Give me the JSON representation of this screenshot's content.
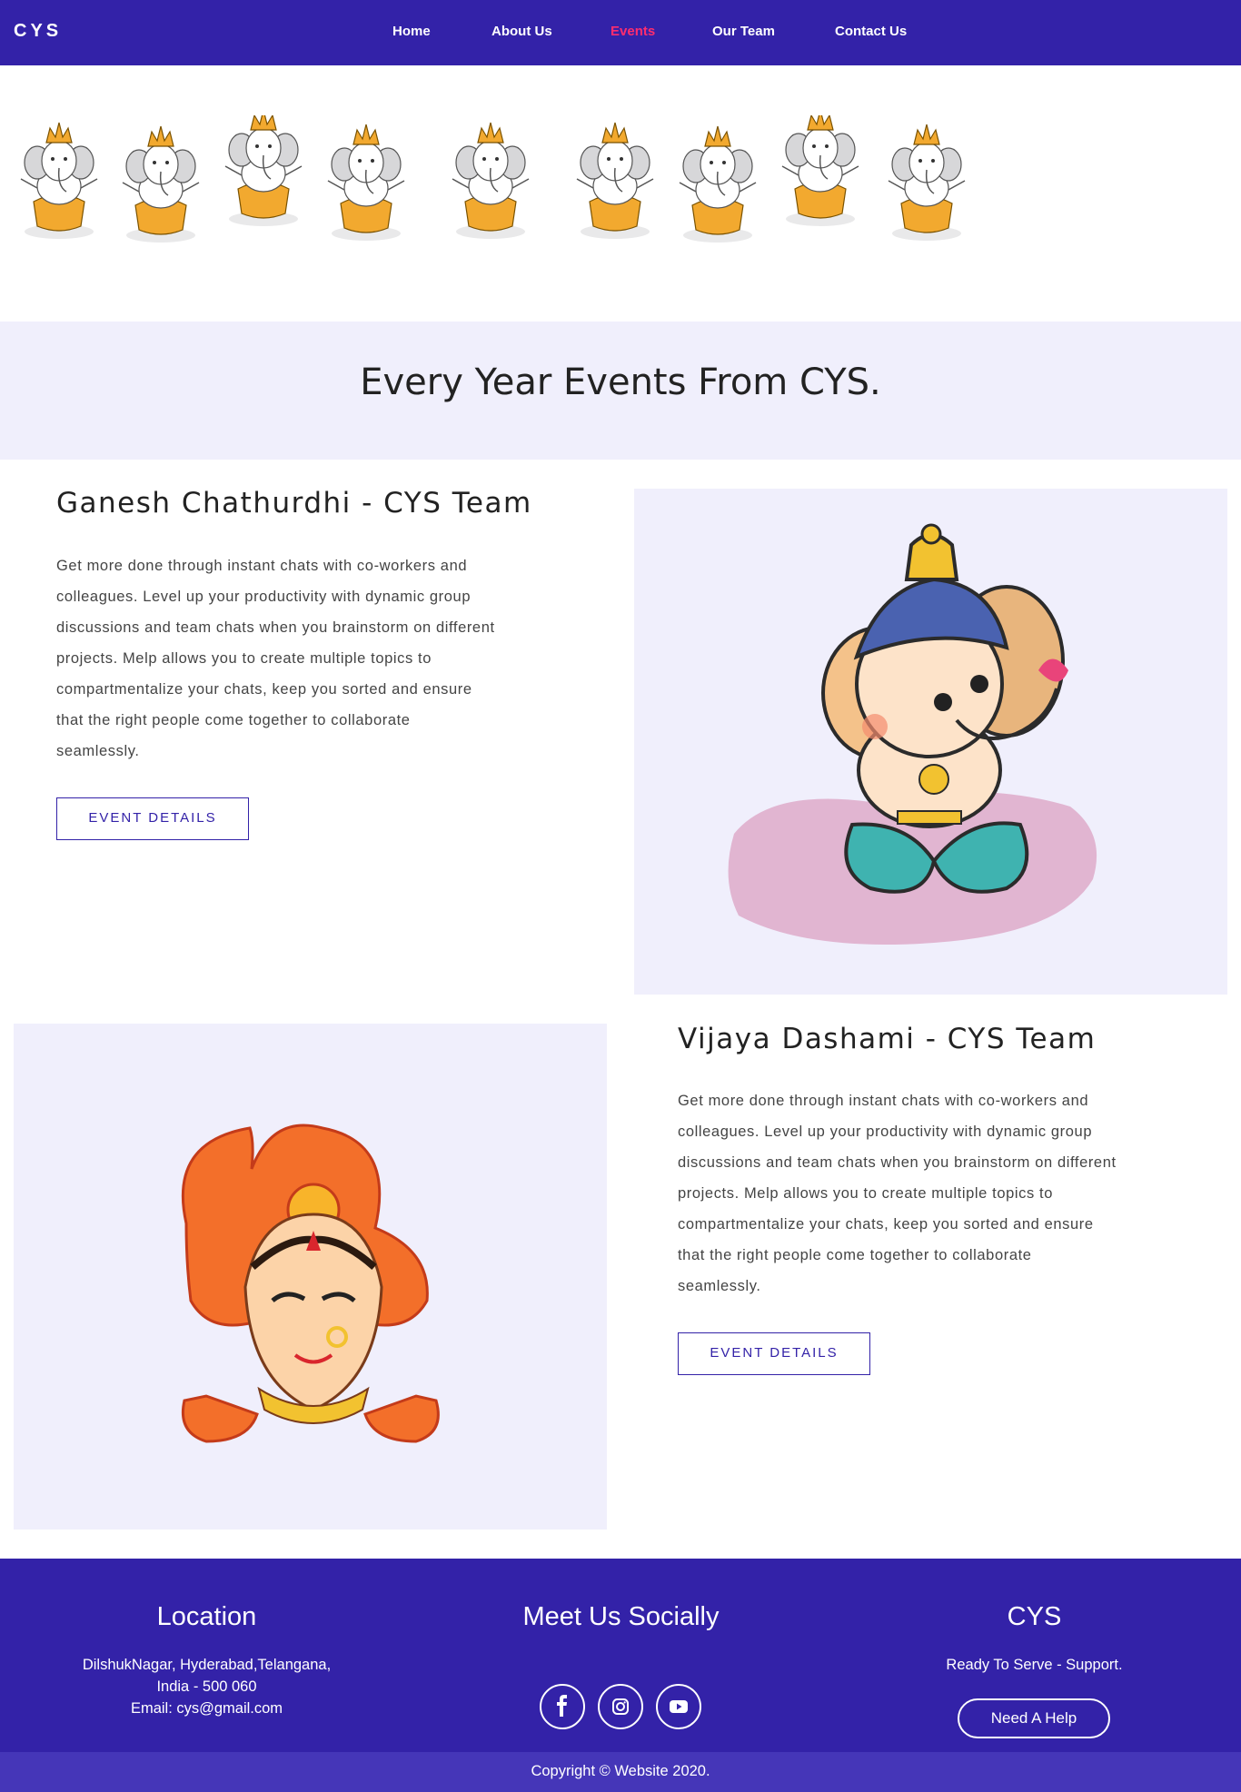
{
  "nav": {
    "brand": "CYS",
    "links": [
      "Home",
      "About Us",
      "Events",
      "Our Team",
      "Contact Us"
    ],
    "active": "Events"
  },
  "headline": "Every Year Events From CYS.",
  "events": [
    {
      "title": "Ganesh Chathurdhi - CYS Team",
      "lines": [
        "Get more done through instant chats with co-workers and",
        "colleagues. Level up your productivity with dynamic group",
        "discussions and team chats when you brainstorm on different",
        "projects. Melp allows you to create multiple topics to",
        "compartmentalize your chats, keep you sorted and ensure",
        "that the right people come together to collaborate",
        "seamlessly."
      ],
      "button": "EVENT DETAILS",
      "image": "ganesha-illustration"
    },
    {
      "title": "Vijaya Dashami - CYS Team",
      "lines": [
        "Get more done through instant chats with co-workers and",
        "colleagues. Level up your productivity with dynamic group",
        "discussions and team chats when you brainstorm on different",
        "projects. Melp allows you to create multiple topics to",
        "compartmentalize your chats, keep you sorted and ensure",
        "that the right people come together to collaborate",
        "seamlessly."
      ],
      "button": "EVENT DETAILS",
      "image": "durga-illustration"
    }
  ],
  "footer": {
    "location": {
      "heading": "Location",
      "line1": "DilshukNagar, Hyderabad,Telangana,",
      "line2": "India - 500 060",
      "line3": "Email: cys@gmail.com"
    },
    "social": {
      "heading": "Meet Us Socially",
      "icons": [
        "facebook-icon",
        "instagram-icon",
        "youtube-icon"
      ]
    },
    "brand": {
      "heading": "CYS",
      "tagline": "Ready To Serve - Support.",
      "button": "Need A Help"
    }
  },
  "copyright": "Copyright © Website 2020.",
  "colors": {
    "nav_bg": "#3322a8",
    "active_link": "#ff2d6e",
    "band_bg": "#f0effc",
    "copyright_bg": "#4536b8"
  }
}
